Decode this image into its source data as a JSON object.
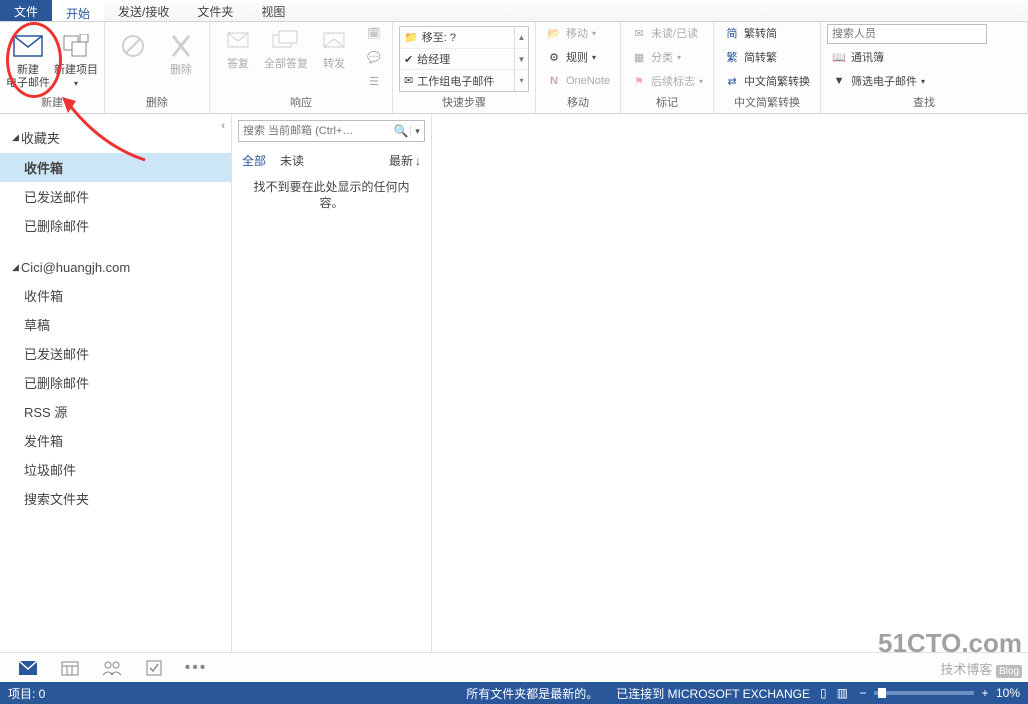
{
  "tabs": {
    "file": "文件",
    "home": "开始",
    "sendrecv": "发送/接收",
    "folder": "文件夹",
    "view": "视图"
  },
  "ribbon": {
    "group_new": {
      "label": "新建",
      "new_mail": "新建\n电子邮件",
      "new_item": "新建项目"
    },
    "group_delete": {
      "label": "删除",
      "delete": "删除"
    },
    "group_respond": {
      "label": "响应",
      "reply": "答复",
      "reply_all": "全部答复",
      "forward": "转发"
    },
    "group_quick": {
      "label": "快速步骤",
      "move_to": "移至: ?",
      "to_mgr": "给经理",
      "team_mail": "工作组电子邮件"
    },
    "group_move": {
      "label": "移动",
      "move": "移动",
      "rules": "规则",
      "onenote": "OneNote"
    },
    "group_tags": {
      "label": "标记",
      "unread": "未读/已读",
      "categorize": "分类",
      "followup": "后续标志"
    },
    "group_chinese": {
      "label": "中文简繁转换",
      "fanjian": "繁转简",
      "jianfan": "简转繁",
      "convert": "中文简繁转换"
    },
    "group_find": {
      "label": "查找",
      "search_people_ph": "搜索人员",
      "address_book": "通讯簿",
      "filter_mail": "筛选电子邮件"
    }
  },
  "nav": {
    "favorites_hdr": "收藏夹",
    "favorites": [
      "收件箱",
      "已发送邮件",
      "已删除邮件"
    ],
    "account_hdr": "Cici@huangjh.com",
    "account_folders": [
      "收件箱",
      "草稿",
      "已发送邮件",
      "已删除邮件",
      "RSS 源",
      "发件箱",
      "垃圾邮件",
      "搜索文件夹"
    ]
  },
  "list": {
    "search_ph": "搜索 当前邮箱 (Ctrl+…",
    "filter_all": "全部",
    "filter_unread": "未读",
    "sort_newest": "最新",
    "empty": "找不到要在此处显示的任何内容。"
  },
  "status": {
    "items": "项目: 0",
    "sync": "所有文件夹都是最新的。",
    "connected": "已连接到 MICROSOFT EXCHANGE",
    "zoom": "10%"
  },
  "watermark": {
    "big": "51CTO.com",
    "sm": "技术博客",
    "tag": "Blog"
  }
}
